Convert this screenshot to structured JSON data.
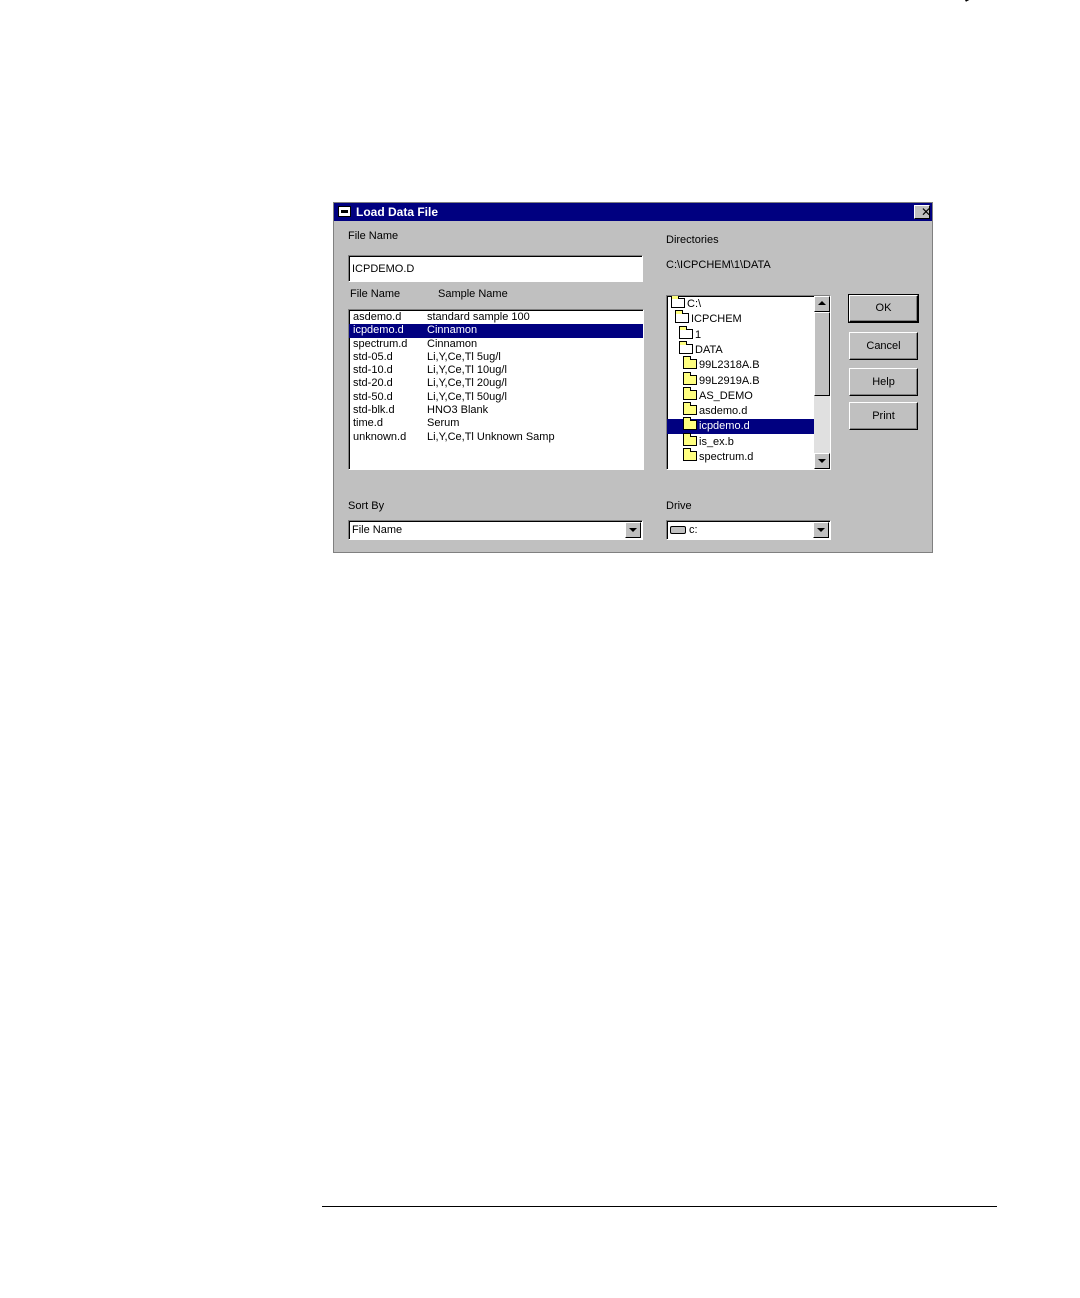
{
  "dialog": {
    "title": "Load Data File",
    "close_glyph": "✕",
    "file_name_label": "File Name",
    "file_name_value": "ICPDEMO.D",
    "list_headers": {
      "file_name": "File Name",
      "sample_name": "Sample Name"
    },
    "files": [
      {
        "file": "asdemo.d",
        "sample": "standard sample 100"
      },
      {
        "file": "icpdemo.d",
        "sample": "Cinnamon",
        "selected": true
      },
      {
        "file": "spectrum.d",
        "sample": "Cinnamon"
      },
      {
        "file": "std-05.d",
        "sample": "Li,Y,Ce,Tl 5ug/l"
      },
      {
        "file": "std-10.d",
        "sample": "Li,Y,Ce,Tl 10ug/l"
      },
      {
        "file": "std-20.d",
        "sample": "Li,Y,Ce,Tl 20ug/l"
      },
      {
        "file": "std-50.d",
        "sample": "Li,Y,Ce,Tl 50ug/l"
      },
      {
        "file": "std-blk.d",
        "sample": "HNO3 Blank"
      },
      {
        "file": "time.d",
        "sample": "Serum"
      },
      {
        "file": "unknown.d",
        "sample": "Li,Y,Ce,Tl Unknown Samp"
      }
    ],
    "directories_label": "Directories",
    "current_path": "C:\\ICPCHEM\\1\\DATA",
    "directories": [
      {
        "name": "C:\\",
        "open": true
      },
      {
        "name": "ICPCHEM",
        "open": true
      },
      {
        "name": "1",
        "open": true
      },
      {
        "name": "DATA",
        "open": true
      },
      {
        "name": "99L2318A.B"
      },
      {
        "name": "99L2919A.B"
      },
      {
        "name": "AS_DEMO"
      },
      {
        "name": "asdemo.d"
      },
      {
        "name": "icpdemo.d",
        "selected": true
      },
      {
        "name": "is_ex.b"
      },
      {
        "name": "spectrum.d"
      }
    ],
    "buttons": {
      "ok": "OK",
      "cancel": "Cancel",
      "help": "Help",
      "print": "Print"
    },
    "sort_by_label": "Sort By",
    "sort_by_value": "File Name",
    "drive_label": "Drive",
    "drive_value": "c:"
  }
}
